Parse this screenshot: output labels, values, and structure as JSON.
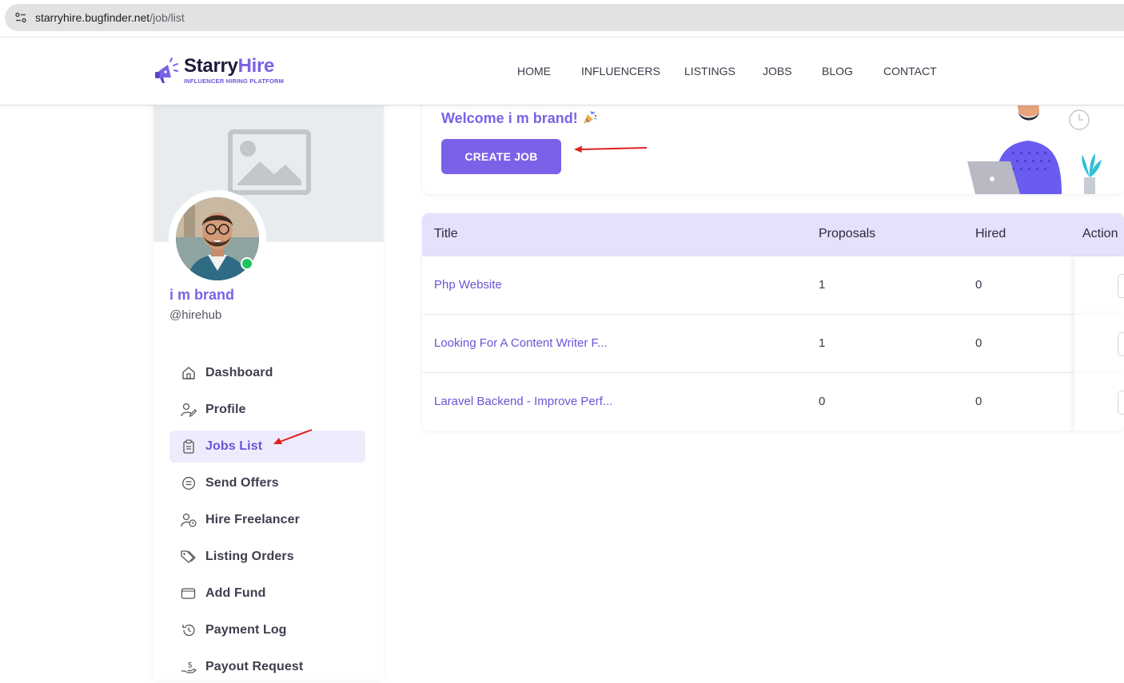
{
  "browser": {
    "url_host": "starryhire.bugfinder.net",
    "url_path": "/job/list"
  },
  "header": {
    "logo_name_a": "Starry",
    "logo_name_b": "Hire",
    "logo_tagline": "INFLUENCER HIRING PLATFORM",
    "nav": [
      "HOME",
      "INFLUENCERS",
      "LISTINGS",
      "JOBS",
      "BLOG",
      "CONTACT"
    ]
  },
  "sidebar": {
    "user_name": "i m brand",
    "user_handle": "@hirehub",
    "status": "online",
    "items": [
      {
        "label": "Dashboard",
        "icon": "home-icon",
        "active": false
      },
      {
        "label": "Profile",
        "icon": "user-edit-icon",
        "active": false
      },
      {
        "label": "Jobs List",
        "icon": "clipboard-list-icon",
        "active": true
      },
      {
        "label": "Send Offers",
        "icon": "list-circle-icon",
        "active": false
      },
      {
        "label": "Hire Freelancer",
        "icon": "user-clock-icon",
        "active": false
      },
      {
        "label": "Listing Orders",
        "icon": "tags-icon",
        "active": false
      },
      {
        "label": "Add Fund",
        "icon": "wallet-icon",
        "active": false
      },
      {
        "label": "Payment Log",
        "icon": "history-icon",
        "active": false
      },
      {
        "label": "Payout Request",
        "icon": "hand-dollar-icon",
        "active": false
      }
    ]
  },
  "welcome": {
    "greeting": "Welcome i m brand!",
    "create_button": "CREATE JOB"
  },
  "jobs_table": {
    "columns": [
      "Title",
      "Proposals",
      "Hired",
      "Action"
    ],
    "rows": [
      {
        "title": "Php Website",
        "proposals": "1",
        "hired": "0"
      },
      {
        "title": "Looking For A Content Writer F...",
        "proposals": "1",
        "hired": "0"
      },
      {
        "title": "Laravel Backend - Improve Perf...",
        "proposals": "0",
        "hired": "0"
      }
    ]
  },
  "colors": {
    "brand": "#7b61e8",
    "table_header_bg": "#e4e1fc",
    "active_item_bg": "#eeebfd",
    "online": "#20c35e",
    "annotation": "#e02020"
  }
}
